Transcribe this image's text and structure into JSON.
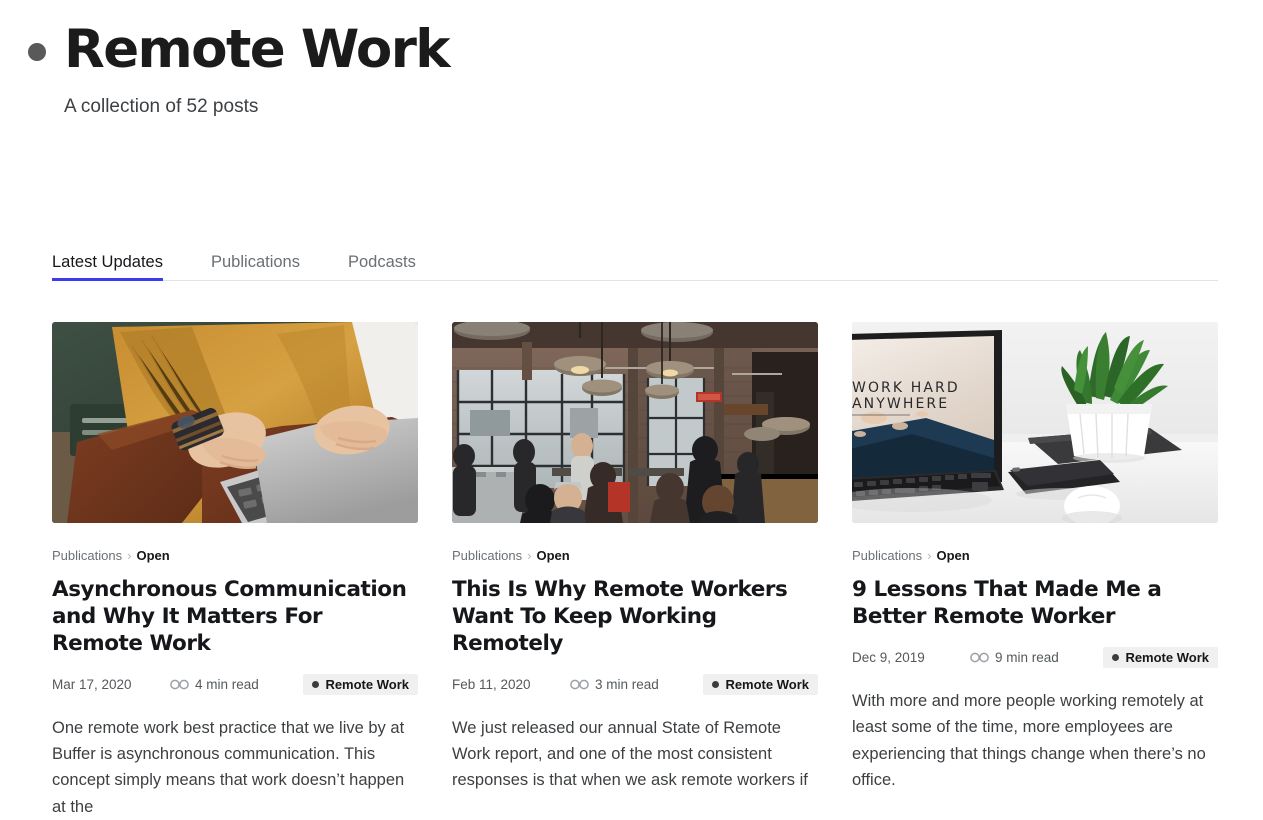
{
  "header": {
    "title": "Remote Work",
    "subtitle": "A collection of 52 posts",
    "dot_color": "#595959"
  },
  "tabs": {
    "active_index": 0,
    "accent_color": "#3b3bf0",
    "items": [
      {
        "label": "Latest Updates"
      },
      {
        "label": "Publications"
      },
      {
        "label": "Podcasts"
      }
    ]
  },
  "posts": [
    {
      "breadcrumb_parent": "Publications",
      "breadcrumb_sep": "›",
      "breadcrumb_current": "Open",
      "title": "Asynchronous Communication and Why It Matters For Remote Work",
      "date": "Mar 17, 2020",
      "read_time": "4 min read",
      "tag": "Remote Work",
      "excerpt": "One remote work best practice that we live by at Buffer is asynchronous communication. This concept simply means that work doesn’t happen at the",
      "image_alt": "person-in-mustard-sweater-typing-on-laptop"
    },
    {
      "breadcrumb_parent": "Publications",
      "breadcrumb_sep": "›",
      "breadcrumb_current": "Open",
      "title": "This Is Why Remote Workers Want To Keep Working Remotely",
      "date": "Feb 11, 2020",
      "read_time": "3 min read",
      "tag": "Remote Work",
      "excerpt": "We just released our annual State of Remote Work report, and one of the most consistent responses is that when we ask remote workers if",
      "image_alt": "industrial-cafe-interior-with-pendant-lamps-and-people"
    },
    {
      "breadcrumb_parent": "Publications",
      "breadcrumb_sep": "›",
      "breadcrumb_current": "Open",
      "title": "9 Lessons That Made Me a Better Remote Worker",
      "date": "Dec 9, 2019",
      "read_time": "9 min read",
      "tag": "Remote Work",
      "excerpt": "With more and more people working remotely at least some of the time, more employees are experiencing that things change when there’s no office.",
      "image_alt": "laptop-with-work-hard-anywhere-screen-plant-phone-on-white-desk",
      "laptop_screen_line1": "WORK HARD",
      "laptop_screen_line2": "ANYWHERE"
    }
  ]
}
